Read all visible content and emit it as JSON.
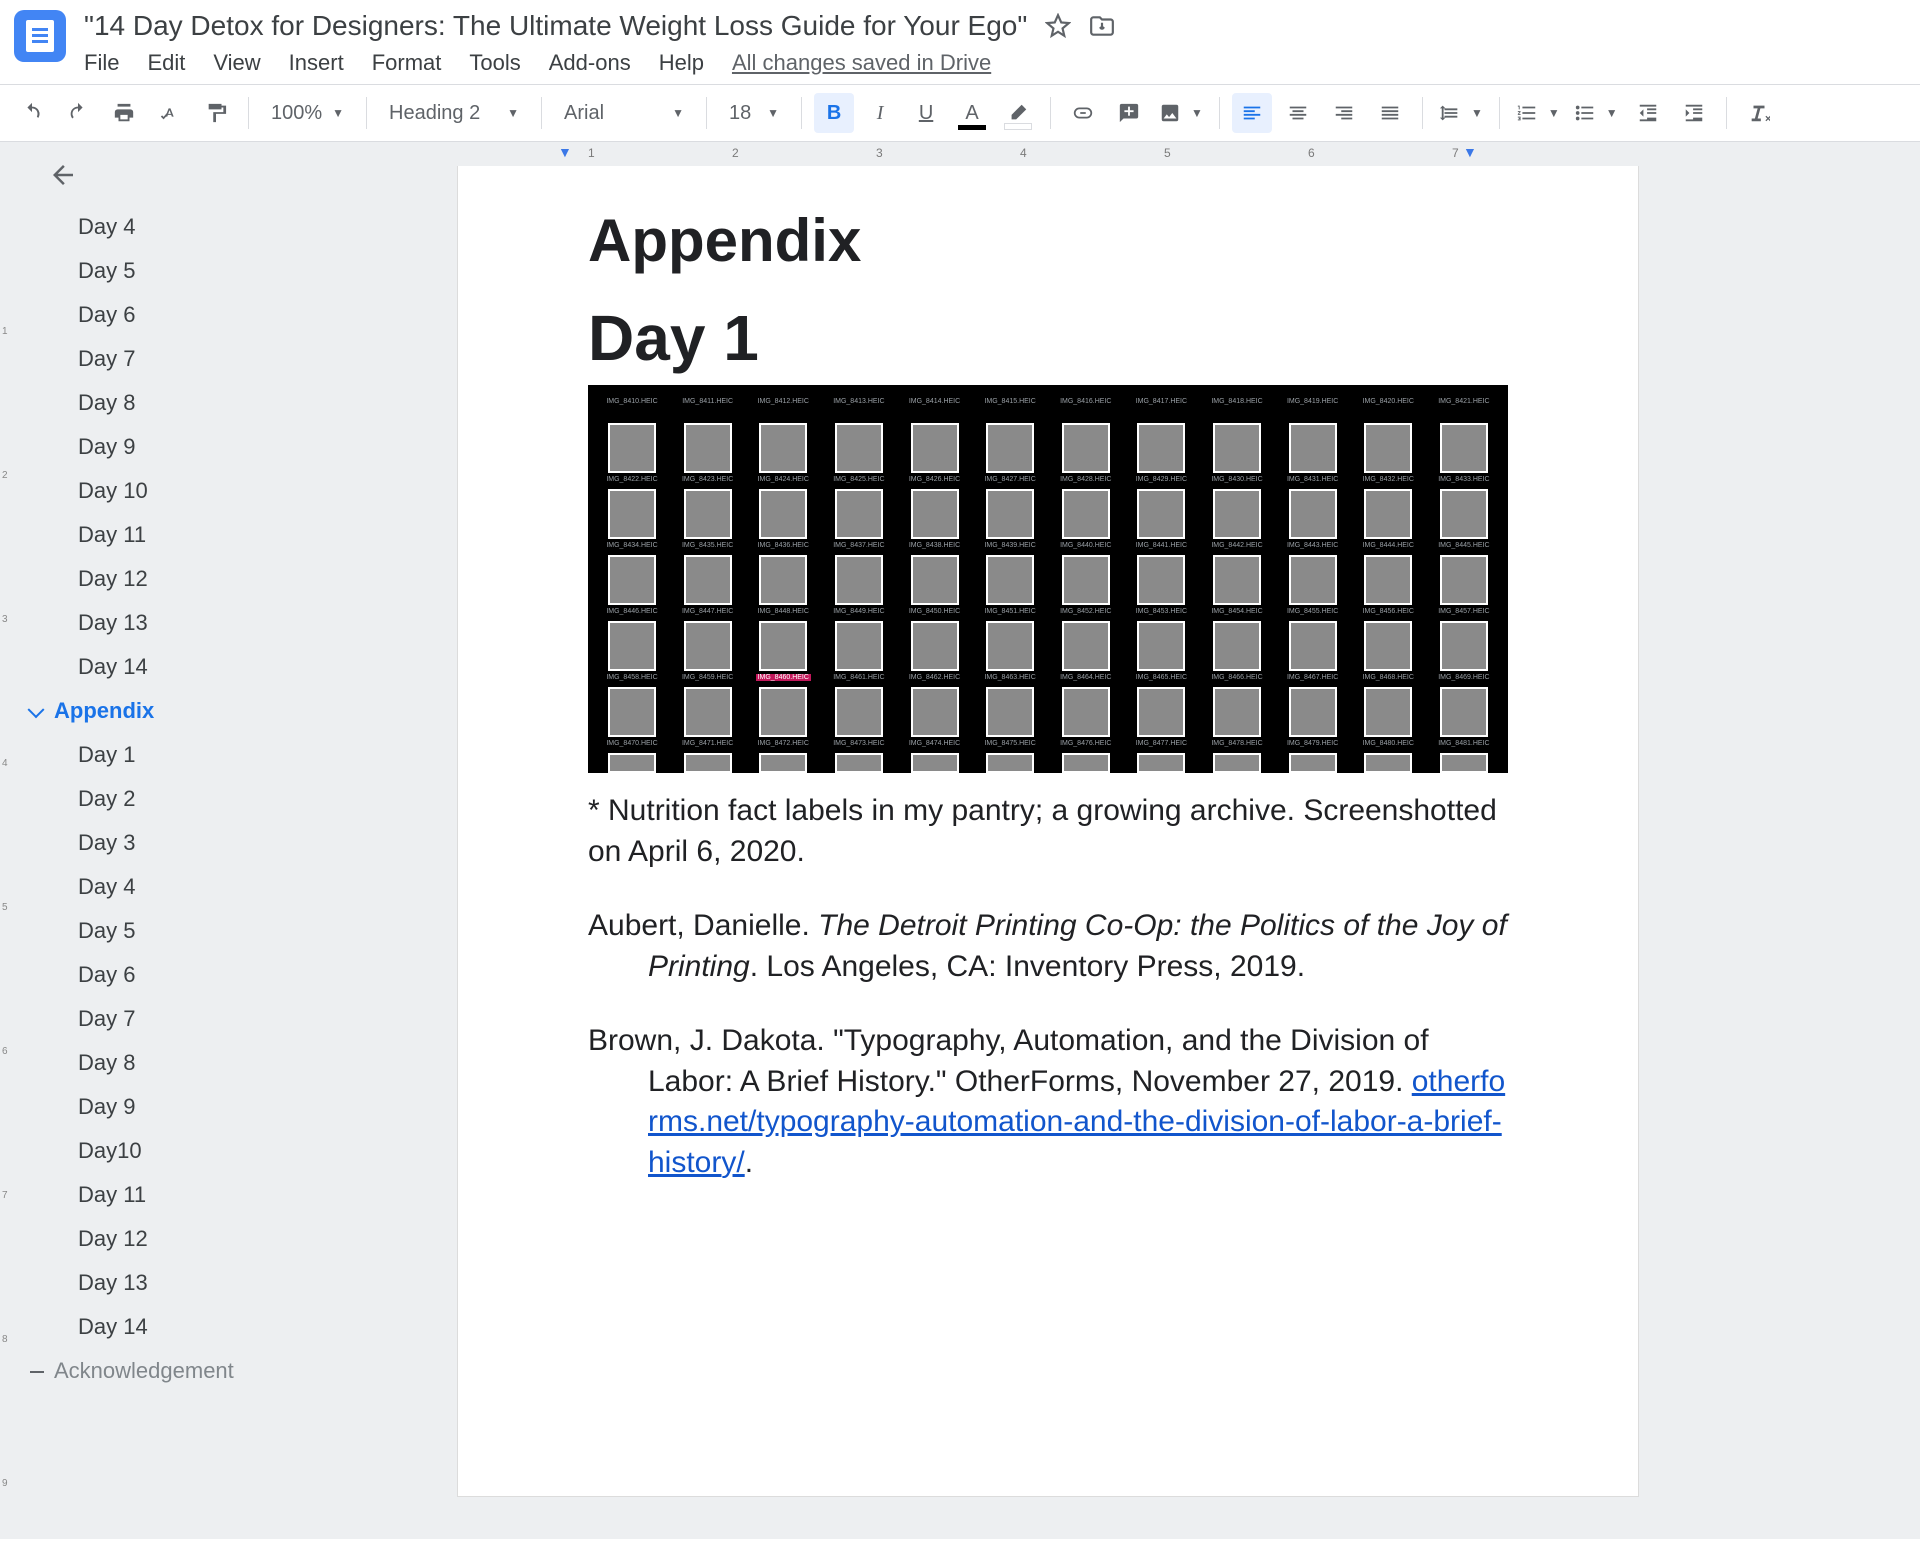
{
  "doc_title": "\"14 Day Detox for Designers: The Ultimate Weight Loss Guide for Your Ego\"",
  "menus": [
    "File",
    "Edit",
    "View",
    "Insert",
    "Format",
    "Tools",
    "Add-ons",
    "Help"
  ],
  "save_status": "All changes saved in Drive",
  "toolbar": {
    "zoom": "100%",
    "style": "Heading 2",
    "font": "Arial",
    "size": "18"
  },
  "outline": {
    "upper": [
      "Day 4",
      "Day 5",
      "Day 6",
      "Day 7",
      "Day 8",
      "Day 9",
      "Day 10",
      "Day 11",
      "Day 12",
      "Day 13",
      "Day 14"
    ],
    "appendix_label": "Appendix",
    "appendix_items": [
      "Day 1",
      "Day 2",
      "Day 3",
      "Day 4",
      "Day 5",
      "Day 6",
      "Day 7",
      "Day 8",
      "Day 9",
      "Day10",
      "Day 11",
      "Day 12",
      "Day 13",
      "Day 14"
    ],
    "ack_label": "Acknowledgement"
  },
  "page": {
    "h_appendix": "Appendix",
    "h_day1": "Day 1",
    "thumb_label_prefix": "IMG_84",
    "thumb_label_suffix": ".HEIC",
    "caption": "* Nutrition fact labels in my pantry; a growing archive. Screenshotted on April 6, 2020.",
    "ref1_a": "Aubert, Danielle. ",
    "ref1_i": "The Detroit Printing Co-Op: the Politics of the Joy of Printing",
    "ref1_b": ". Los Angeles, CA: Inventory Press, 2019.",
    "ref2_a": "Brown, J. Dakota. \"Typography, Automation, and the Division of Labor: A Brief History.\" OtherForms, November 27, 2019. ",
    "ref2_link": "otherforms.net/typography-automation-and-the-division-of-labor-a-brief-history/",
    "ref2_b": "."
  },
  "ruler": {
    "nums": [
      1,
      2,
      3,
      4,
      5,
      6,
      7
    ]
  }
}
